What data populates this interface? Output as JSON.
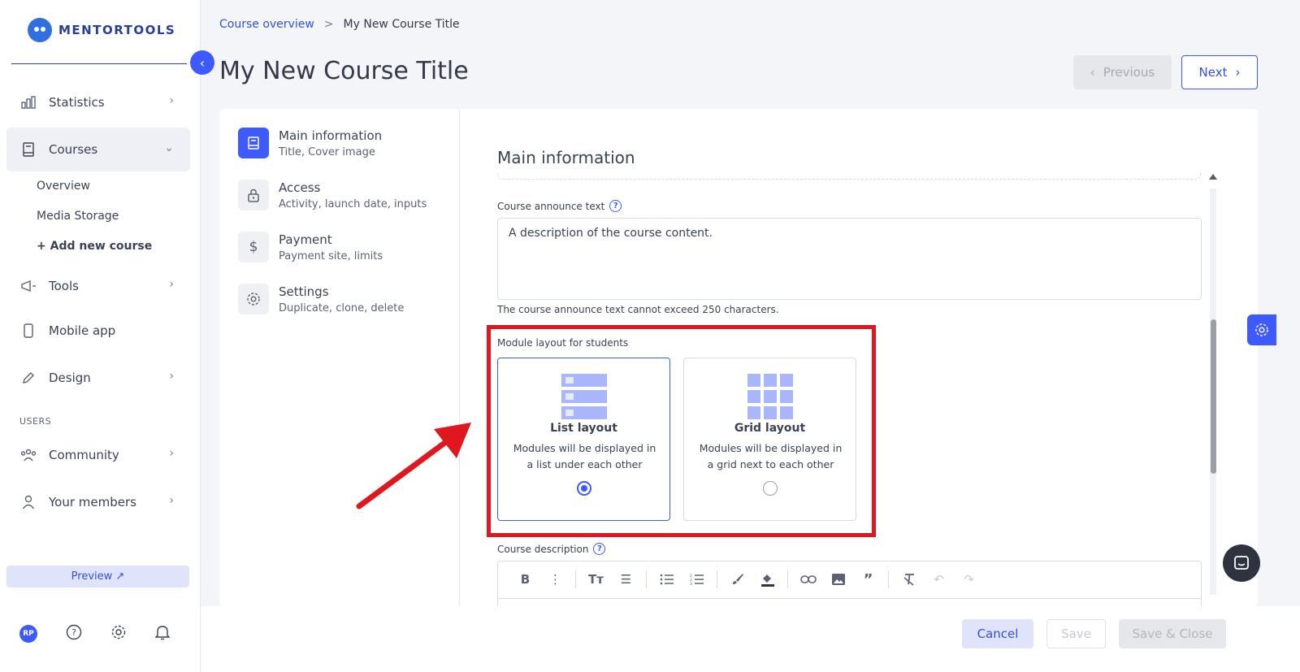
{
  "brand": {
    "name": "MENTORTOOLS"
  },
  "sidebar": {
    "items": [
      {
        "label": "Statistics"
      },
      {
        "label": "Courses"
      },
      {
        "label": "Tools"
      },
      {
        "label": "Mobile app"
      },
      {
        "label": "Design"
      },
      {
        "label": "Community"
      },
      {
        "label": "Your members"
      }
    ],
    "course_sub": [
      "Overview",
      "Media Storage",
      "+ Add new course"
    ],
    "section_users": "USERS",
    "preview": "Preview ↗",
    "avatar_initials": "RP"
  },
  "header": {
    "breadcrumb_link": "Course overview",
    "breadcrumb_sep": ">",
    "breadcrumb_current": "My New Course Title",
    "title": "My New Course Title",
    "previous": "Previous",
    "next": "Next"
  },
  "steps": [
    {
      "title": "Main information",
      "sub": "Title, Cover image"
    },
    {
      "title": "Access",
      "sub": "Activity, launch date, inputs"
    },
    {
      "title": "Payment",
      "sub": "Payment site, limits"
    },
    {
      "title": "Settings",
      "sub": "Duplicate, clone, delete"
    }
  ],
  "form": {
    "section_title": "Main information",
    "announce_label": "Course announce text",
    "announce_value": "A description of the course content.",
    "announce_hint": "The course announce text cannot exceed 250 characters.",
    "module_layout_label": "Module layout for students",
    "layouts": [
      {
        "title": "List layout",
        "desc": "Modules will be displayed in a list under each other",
        "selected": true
      },
      {
        "title": "Grid layout",
        "desc": "Modules will be displayed in a grid next to each other",
        "selected": false
      }
    ],
    "description_label": "Course description"
  },
  "footer": {
    "cancel": "Cancel",
    "save": "Save",
    "save_close": "Save & Close"
  },
  "colors": {
    "accent": "#3d5afe",
    "highlight": "#e0171e",
    "arrow": "#e0171e"
  }
}
